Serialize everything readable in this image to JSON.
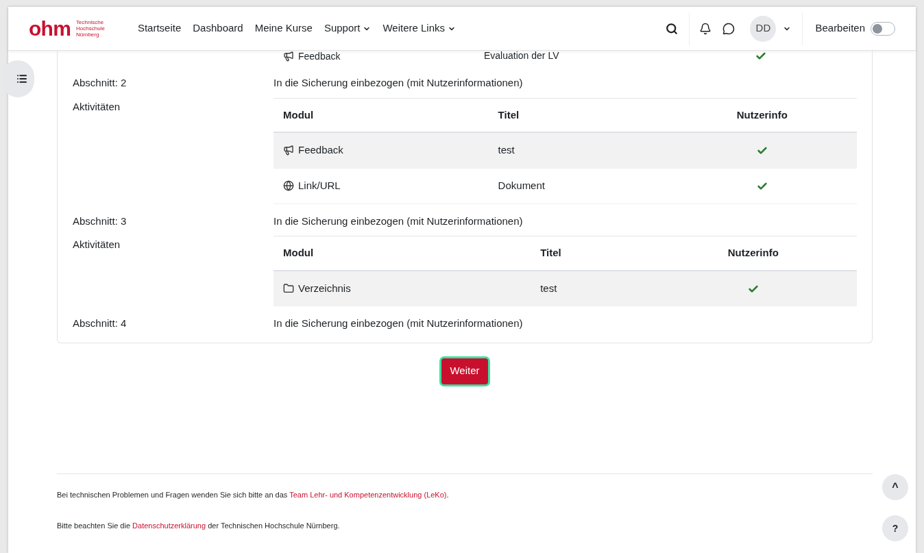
{
  "header": {
    "logo": {
      "wordmark": "ohm",
      "lines": [
        "Technische",
        "Hochschule",
        "Nürnberg"
      ]
    },
    "nav": [
      {
        "label": "Startseite",
        "dropdown": false
      },
      {
        "label": "Dashboard",
        "dropdown": false
      },
      {
        "label": "Meine Kurse",
        "dropdown": false
      },
      {
        "label": "Support",
        "dropdown": true
      },
      {
        "label": "Weitere Links",
        "dropdown": true
      }
    ],
    "avatar": "DD",
    "edit_mode": {
      "label": "Bearbeiten",
      "on": false
    }
  },
  "partial_row": {
    "kind": "feedback",
    "module": "Feedback",
    "title": "Evaluation der LV",
    "user_info": true
  },
  "sections": [
    {
      "label": "Abschnitt: 2",
      "sublabel": "Aktivitäten",
      "status": "In die Sicherung einbezogen (mit Nutzerinformationen)",
      "table": {
        "columns": [
          "Modul",
          "Titel",
          "Nutzerinfo"
        ],
        "rows": [
          {
            "kind": "feedback",
            "module": "Feedback",
            "title": "test",
            "user_info": true
          },
          {
            "kind": "url",
            "module": "Link/URL",
            "title": "Dokument",
            "user_info": true
          }
        ]
      }
    },
    {
      "label": "Abschnitt: 3",
      "sublabel": "Aktivitäten",
      "status": "In die Sicherung einbezogen (mit Nutzerinformationen)",
      "table": {
        "columns": [
          "Modul",
          "Titel",
          "Nutzerinfo"
        ],
        "rows": [
          {
            "kind": "folder",
            "module": "Verzeichnis",
            "title": "test",
            "user_info": true
          }
        ]
      }
    },
    {
      "label": "Abschnitt: 4",
      "status": "In die Sicherung einbezogen (mit Nutzerinformationen)"
    }
  ],
  "continue_button": "Weiter",
  "footer": [
    {
      "before": "Bei technischen Problemen und Fragen wenden Sie sich bitte an das ",
      "link": "Team Lehr- und Kompetenzentwicklung (LeKo)",
      "after": "."
    },
    {
      "before": "Bitte beachten Sie die ",
      "link": "Datenschutzerklärung",
      "after": " der Technischen Hochschule Nürnberg."
    }
  ],
  "float_buttons": {
    "top": "^",
    "help": "?"
  }
}
